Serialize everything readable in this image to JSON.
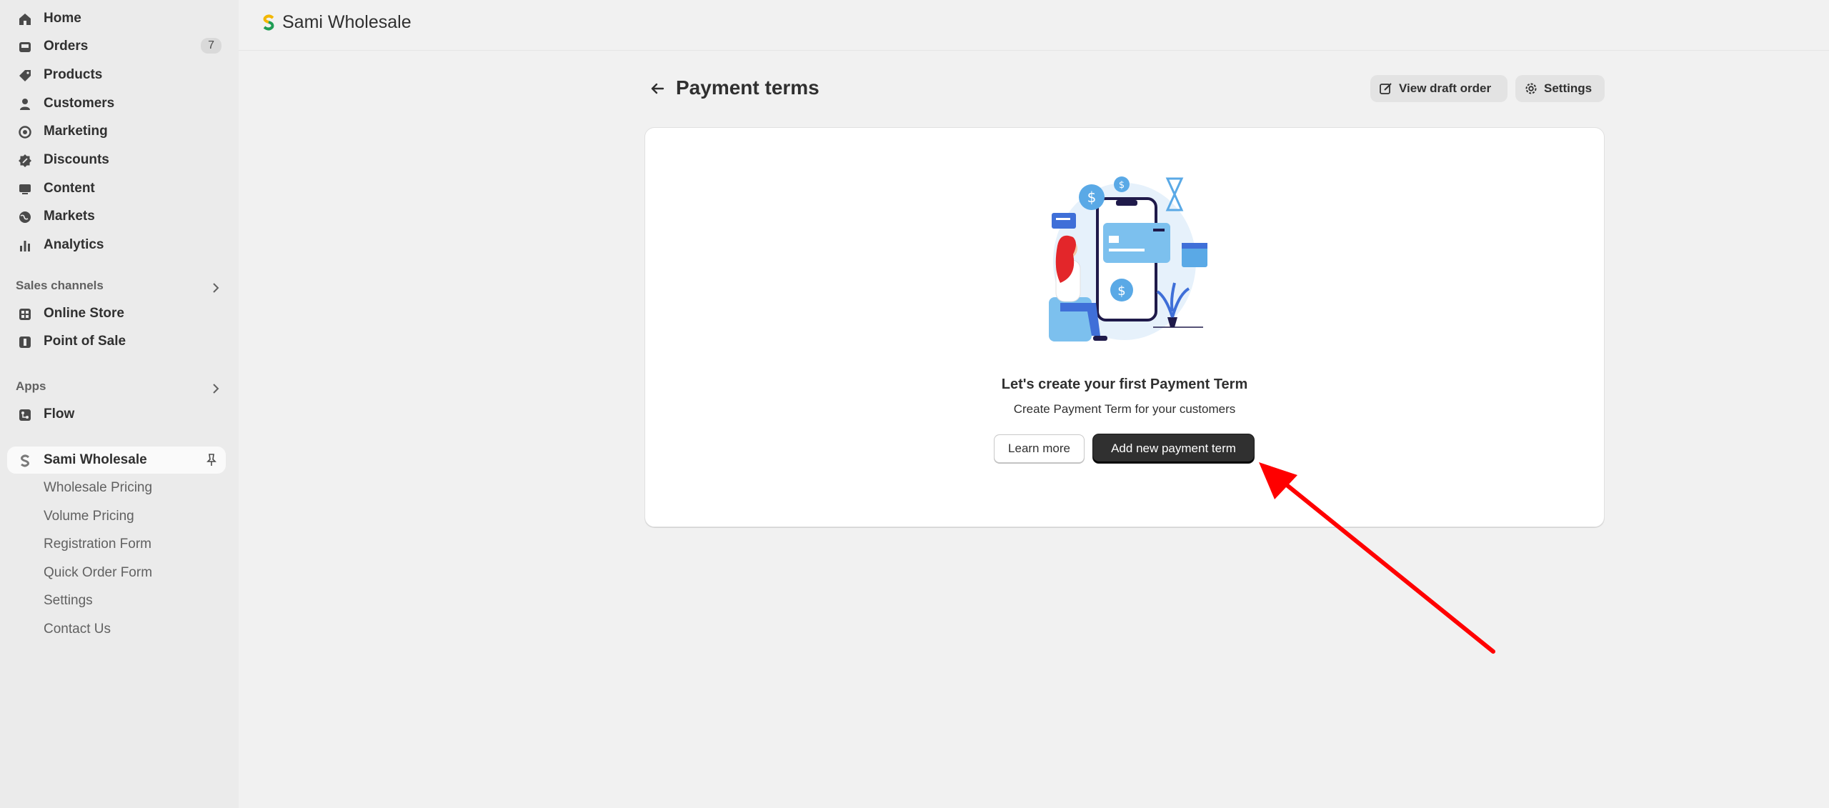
{
  "sidebar": {
    "items": [
      {
        "label": "Home",
        "icon": "home-icon"
      },
      {
        "label": "Orders",
        "icon": "inbox-icon",
        "badge": "7"
      },
      {
        "label": "Products",
        "icon": "tag-icon"
      },
      {
        "label": "Customers",
        "icon": "person-icon"
      },
      {
        "label": "Marketing",
        "icon": "target-icon"
      },
      {
        "label": "Discounts",
        "icon": "discount-icon"
      },
      {
        "label": "Content",
        "icon": "content-icon"
      },
      {
        "label": "Markets",
        "icon": "globe-icon"
      },
      {
        "label": "Analytics",
        "icon": "bar-chart-icon"
      }
    ],
    "sales_channels": {
      "header": "Sales channels",
      "items": [
        {
          "label": "Online Store",
          "icon": "store-icon"
        },
        {
          "label": "Point of Sale",
          "icon": "pos-icon"
        }
      ]
    },
    "apps": {
      "header": "Apps",
      "items": [
        {
          "label": "Flow",
          "icon": "flow-icon"
        }
      ]
    },
    "pinned_app": {
      "label": "Sami Wholesale",
      "icon": "sami-logo-icon",
      "subitems": [
        "Wholesale Pricing",
        "Volume Pricing",
        "Registration Form",
        "Quick Order Form",
        "Settings",
        "Contact Us"
      ]
    }
  },
  "topbar": {
    "title": "Sami Wholesale"
  },
  "page": {
    "title": "Payment terms",
    "actions": {
      "view_draft": "View draft order",
      "settings": "Settings"
    }
  },
  "empty_state": {
    "title": "Let's create your first Payment Term",
    "subtitle": "Create Payment Term for your customers",
    "learn_more": "Learn more",
    "add_new": "Add new payment term"
  },
  "colors": {
    "primary_button": "#303030",
    "annotation_arrow": "#ff0000",
    "illustration_blue": "#5aa9e6"
  }
}
